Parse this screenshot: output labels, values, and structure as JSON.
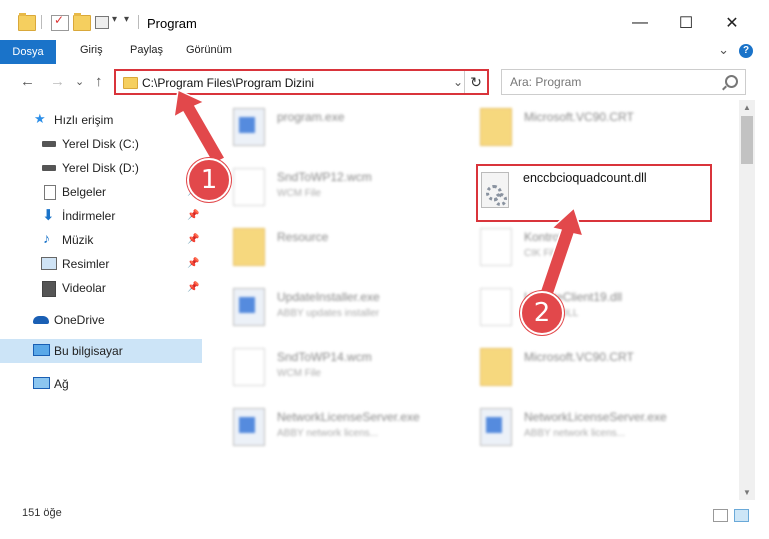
{
  "window": {
    "title": "Program",
    "minimize_symbol": "—",
    "maximize_symbol": "☐",
    "close_symbol": "✕"
  },
  "ribbon": {
    "tabs": [
      "Dosya",
      "Giriş",
      "Paylaş",
      "Görünüm"
    ],
    "help_label": "?",
    "collapse_symbol": "⌄"
  },
  "nav": {
    "back_symbol": "←",
    "forward_symbol": "→",
    "recent_symbol": "⌄",
    "up_symbol": "↑",
    "address": "C:\\Program Files\\Program Dizini",
    "address_dropdown_symbol": "⌄",
    "refresh_symbol": "↻",
    "search_placeholder": "Ara: Program"
  },
  "sidebar": {
    "items": [
      {
        "label": "Hızlı erişim",
        "icon": "star-icon"
      },
      {
        "label": "Yerel Disk (C:)",
        "icon": "drive-icon"
      },
      {
        "label": "Yerel Disk (D:)",
        "icon": "drive-icon"
      },
      {
        "label": "Belgeler",
        "icon": "documents-icon"
      },
      {
        "label": "İndirmeler",
        "icon": "download-icon"
      },
      {
        "label": "Müzik",
        "icon": "music-icon"
      },
      {
        "label": "Resimler",
        "icon": "pictures-icon"
      },
      {
        "label": "Videolar",
        "icon": "video-icon"
      },
      {
        "label": "OneDrive",
        "icon": "cloud-icon"
      },
      {
        "label": "Bu bilgisayar",
        "icon": "computer-icon"
      },
      {
        "label": "Ağ",
        "icon": "network-icon"
      }
    ]
  },
  "files": {
    "left": [
      {
        "name": "program.exe",
        "desc": ""
      },
      {
        "name": "SndToWP12.wcm",
        "desc": "WCM File"
      },
      {
        "name": "Resource",
        "desc": ""
      },
      {
        "name": "UpdateInstaller.exe",
        "desc": "ABBY updates installer"
      },
      {
        "name": "SndToWP14.wcm",
        "desc": "WCM File"
      },
      {
        "name": "NetworkLicenseServer.exe",
        "desc": "ABBY network licens..."
      }
    ],
    "right": [
      {
        "name": "Microsoft.VC90.CRT",
        "desc": ""
      },
      {
        "name": "enccbcioquadcount.dll",
        "desc": ""
      },
      {
        "name": "Kontrolik",
        "desc": "CIK File"
      },
      {
        "name": "UpdateClient19.dll",
        "desc": "Service DLL"
      },
      {
        "name": "Microsoft.VC90.CRT",
        "desc": ""
      },
      {
        "name": "NetworkLicenseServer.exe",
        "desc": "ABBY network licens..."
      }
    ]
  },
  "status": {
    "item_count": "151 öğe"
  },
  "annotations": {
    "step1": "1",
    "step2": "2"
  }
}
